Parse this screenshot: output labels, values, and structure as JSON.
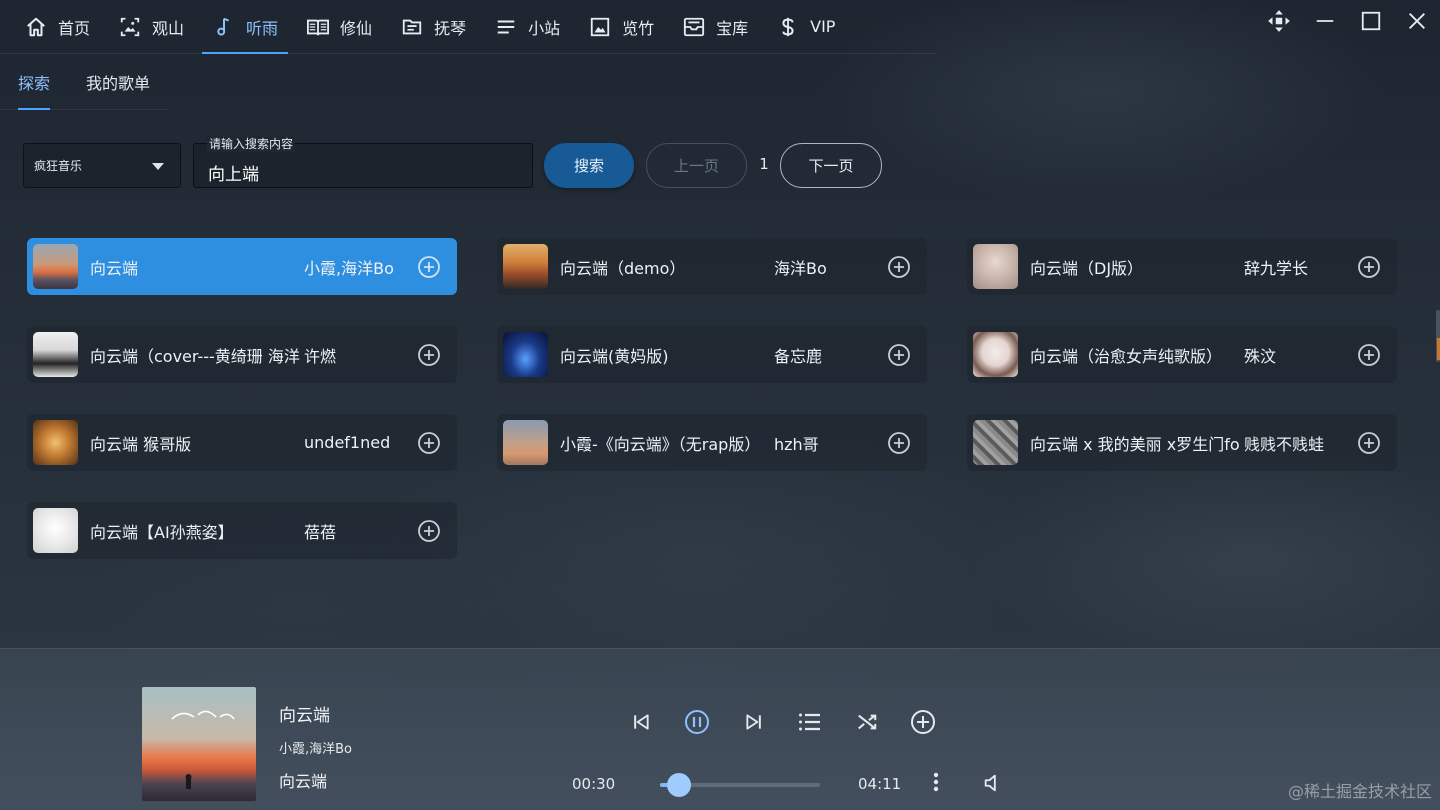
{
  "nav": {
    "items": [
      {
        "label": "首页",
        "icon": "home-icon"
      },
      {
        "label": "观山",
        "icon": "image-frame-icon"
      },
      {
        "label": "听雨",
        "icon": "music-note-icon",
        "active": true
      },
      {
        "label": "修仙",
        "icon": "book-icon"
      },
      {
        "label": "抚琴",
        "icon": "document-icon"
      },
      {
        "label": "小站",
        "icon": "menu-lines-icon"
      },
      {
        "label": "览竹",
        "icon": "picture-icon"
      },
      {
        "label": "宝库",
        "icon": "inbox-icon"
      },
      {
        "label": "VIP",
        "icon": "dollar-icon"
      }
    ]
  },
  "subtabs": [
    {
      "label": "探索",
      "active": true
    },
    {
      "label": "我的歌单"
    }
  ],
  "search": {
    "source": "疯狂音乐",
    "label": "请输入搜索内容",
    "value": "向上端",
    "search_label": "搜索",
    "prev_label": "上一页",
    "page": "1",
    "next_label": "下一页"
  },
  "results": [
    {
      "title": "向云端",
      "artist": "小霞,海洋Bo",
      "active": true
    },
    {
      "title": "向云端（demo）",
      "artist": "海洋Bo"
    },
    {
      "title": "向云端（DJ版）",
      "artist": "辞九学长"
    },
    {
      "title": "向云端（cover---黄绮珊 海洋",
      "artist": "许燃"
    },
    {
      "title": "向云端(黄妈版)",
      "artist": "备忘鹿"
    },
    {
      "title": "向云端（治愈女声纯歌版）",
      "artist": "殊汶"
    },
    {
      "title": "向云端 猴哥版",
      "artist": "undef1ned"
    },
    {
      "title": "小霞-《向云端》（无rap版）",
      "artist": "hzh哥"
    },
    {
      "title": "向云端 x 我的美丽 x罗生门fo",
      "artist": "贱贱不贱蛙"
    },
    {
      "title": "向云端【AI孙燕姿】",
      "artist": "蓓蓓"
    }
  ],
  "player": {
    "title": "向云端",
    "artist": "小霞,海洋Bo",
    "album": "向云端",
    "current_time": "00:30",
    "total_time": "04:11",
    "progress": 0.12
  },
  "watermark": "@稀土掘金技术社区",
  "colors": {
    "accent": "#2e8fe0",
    "active_text": "#8fc0ff",
    "search_button": "#175a96"
  }
}
